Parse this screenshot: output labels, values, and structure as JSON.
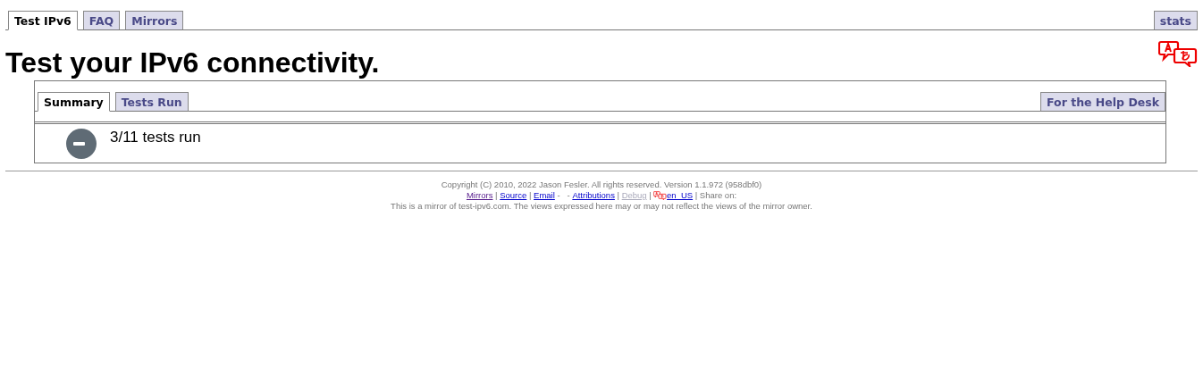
{
  "top_tabs": [
    {
      "label": "Test IPv6",
      "selected": true
    },
    {
      "label": "FAQ",
      "selected": false
    },
    {
      "label": "Mirrors",
      "selected": false
    }
  ],
  "top_right_tab": {
    "label": "stats",
    "selected": false
  },
  "title": "Test your IPv6 connectivity.",
  "panel": {
    "tabs": [
      {
        "label": "Summary",
        "selected": true
      },
      {
        "label": "Tests Run",
        "selected": false
      }
    ],
    "right_tab": {
      "label": "For the Help Desk",
      "selected": false
    },
    "status": {
      "kind": "neutral",
      "text": "3/11 tests run"
    }
  },
  "footer": {
    "copyright": "Copyright (C) 2010, 2022 Jason Fesler. All rights reserved. Version 1.1.972 (958dbf0)",
    "links": [
      {
        "kind": "visited",
        "text": "Mirrors"
      },
      {
        "kind": "text",
        "text": " | "
      },
      {
        "kind": "link",
        "text": "Source"
      },
      {
        "kind": "text",
        "text": " | "
      },
      {
        "kind": "link",
        "text": "Email"
      },
      {
        "kind": "text",
        "text": " -   - "
      },
      {
        "kind": "link",
        "text": "Attributions"
      },
      {
        "kind": "text",
        "text": " | "
      },
      {
        "kind": "disabled",
        "text": "Debug"
      },
      {
        "kind": "text",
        "text": " | "
      },
      {
        "kind": "lang-icon"
      },
      {
        "kind": "link",
        "text": "en_US"
      },
      {
        "kind": "text",
        "text": " | Share on:"
      }
    ],
    "mirror_note": "This is a mirror of test-ipv6.com. The views expressed here may or may not reflect the views of the mirror owner."
  }
}
